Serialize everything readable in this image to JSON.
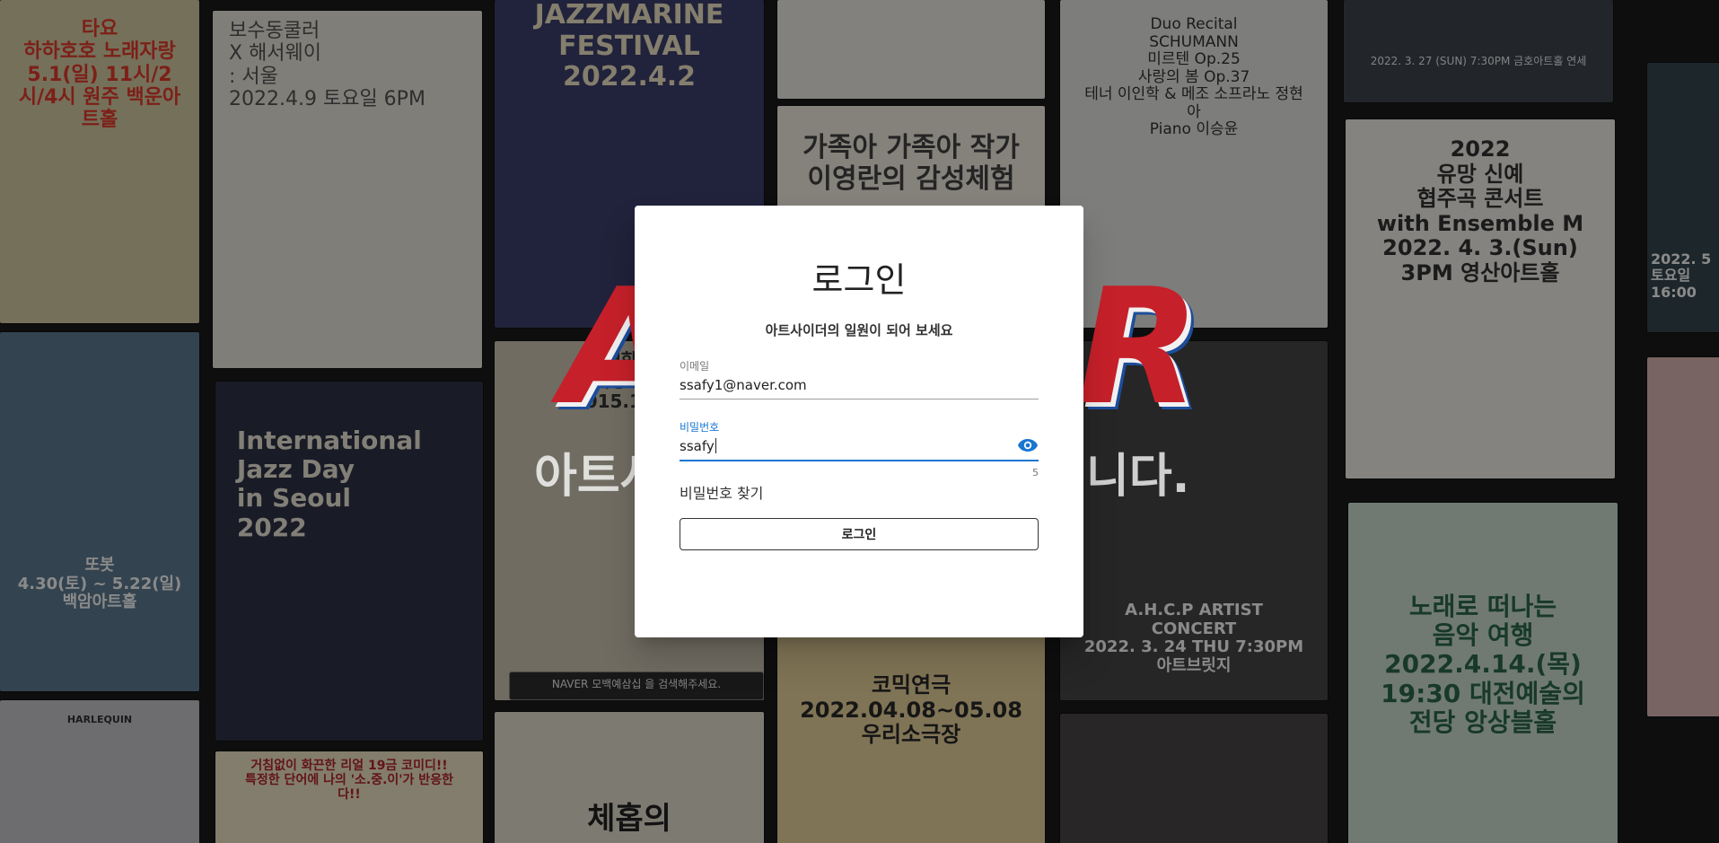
{
  "background": {
    "brand_left": "A",
    "brand_right": "R",
    "tagline_left": "아트사",
    "tagline_right": "니다.",
    "posters": [
      {
        "text": "타요\n하하호호 노래자랑\n5.1(일) 11시/2시/4시 원주 백운아트홀"
      },
      {
        "text": "보수동쿨러\nX 해서웨이\n: 서울\n2022.4.9 토요일 6PM"
      },
      {
        "text": "JAZZMARINE\nFESTIVAL\n2022.4.2"
      },
      {
        "text": "Duo Recital\nSCHUMANN\n미르텐 Op.25\n사랑의 봄 Op.37\n테너 이인학 & 메조 소프라노 정현아\nPiano 이승윤"
      },
      {
        "text": "2022. 3. 27 (SUN) 7:30PM 금호아트홀 연세"
      },
      {
        "text": "가족아 가족아 작가\n이영란의 감성체험"
      },
      {
        "text": "2022\n유망 신예\n협주곡 콘서트\nwith Ensemble M\n2022. 4. 3.(Sun) 3PM 영산아트홀"
      },
      {
        "text": "International\nJazz Day\nin Seoul\n2022"
      },
      {
        "text": "대학로\n생계형 코미디\n2015.11.21"
      },
      {
        "text": "A.H.C.P ARTIST CONCERT\n2022. 3. 24 THU 7:30PM\n아트브릿지"
      },
      {
        "text": "노래로 떠나는\n음악 여행\n2022.4.14.(목) 19:30 대전예술의전당 앙상블홀"
      },
      {
        "text": "또봇\n4.30(토) ~ 5.22(일) 백암아트홀"
      },
      {
        "text": "거침없이 화끈한 리얼 19금 코미디!!\n특정한 단어에 나의 '소.중.이'가 반응한다!!"
      },
      {
        "text": "체홉의"
      },
      {
        "text": "코믹연극\n2022.04.08~05.08\n우리소극장"
      },
      {
        "text": "HARLEQUIN"
      },
      {
        "text": "2022. 5\n토요일 16:00"
      },
      {
        "text": "NAVER 모백예삼십 을 검색해주세요."
      }
    ]
  },
  "dialog": {
    "title": "로그인",
    "subtitle": "아트사이더의 일원이 되어 보세요",
    "email": {
      "label": "이메일",
      "value": "ssafy1@naver.com"
    },
    "password": {
      "label": "비밀번호",
      "value": "ssafy",
      "counter": "5",
      "toggle_icon": "eye-icon"
    },
    "find_password": "비밀번호 찾기",
    "login_button": "로그인"
  },
  "colors": {
    "accent": "#1976d2",
    "brand_red": "#c6202a",
    "brand_blue": "#1d4d9b"
  }
}
